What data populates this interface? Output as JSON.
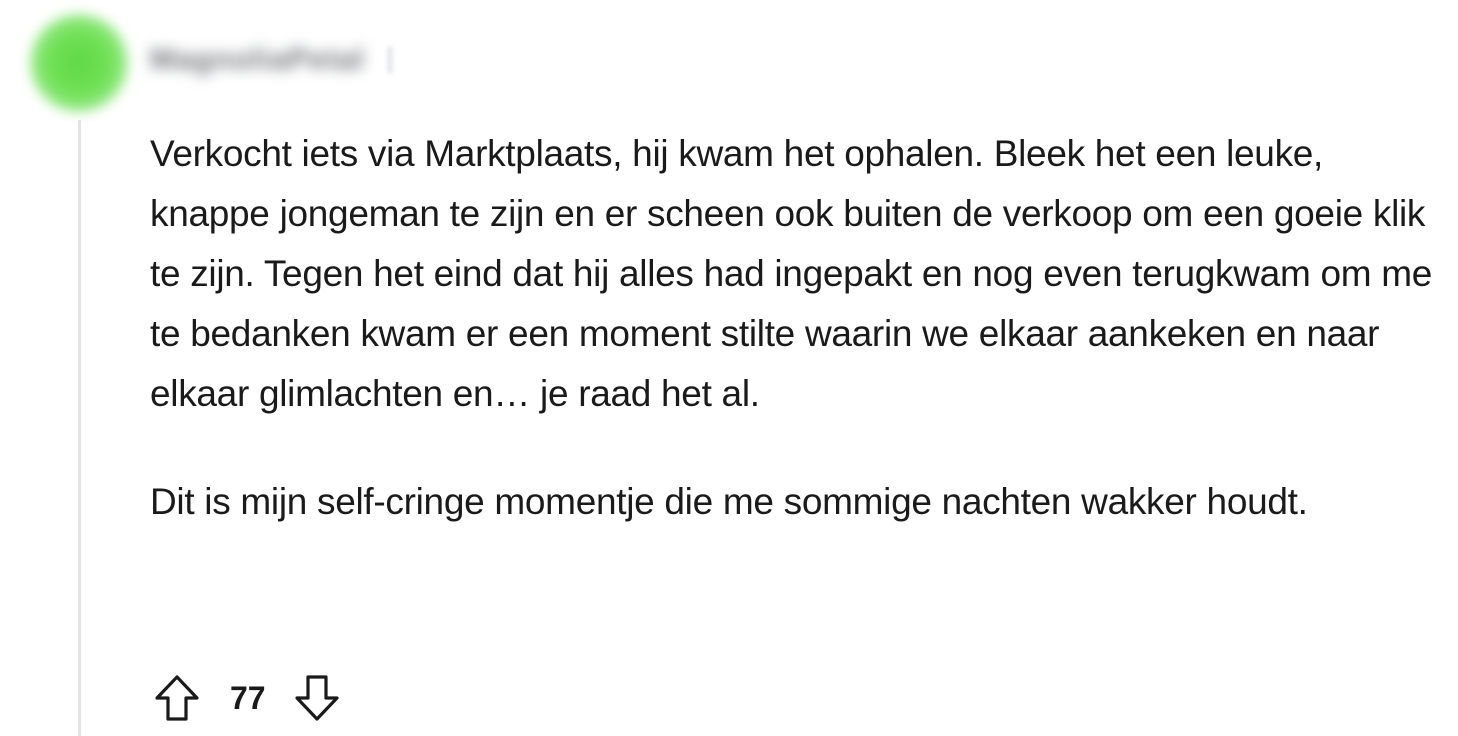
{
  "comment": {
    "author": "MagnoliaPetal",
    "paragraphs": [
      "Verkocht iets via Marktplaats, hij kwam het ophalen. Bleek het een leuke, knappe jongeman te zijn en er scheen ook buiten de verkoop om een goeie klik te zijn. Tegen het eind dat hij alles had ingepakt en nog even terugkwam om me te bedanken kwam er een moment stilte waarin we elkaar aankeken en naar elkaar glimlachten en… je raad het al.",
      "Dit is mijn self-cringe momentje die me sommige nachten wakker houdt."
    ],
    "score": "77"
  },
  "icons": {
    "avatar": "avatar",
    "upvote": "arrow-up-outline-icon",
    "downvote": "arrow-down-outline-icon"
  },
  "colors": {
    "avatar": "#5fd846",
    "text": "#1a1a1b",
    "thread_line": "#e1e3e6"
  }
}
